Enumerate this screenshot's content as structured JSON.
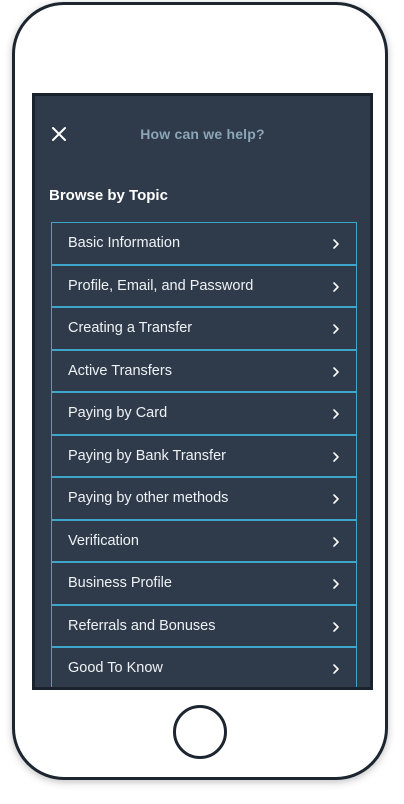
{
  "header": {
    "title": "How can we help?",
    "close_icon": "close-icon"
  },
  "browse": {
    "title": "Browse by Topic",
    "topics": [
      {
        "label": "Basic Information"
      },
      {
        "label": "Profile, Email, and Password"
      },
      {
        "label": "Creating a Transfer"
      },
      {
        "label": "Active Transfers"
      },
      {
        "label": "Paying by Card"
      },
      {
        "label": "Paying by Bank Transfer"
      },
      {
        "label": "Paying by other methods"
      },
      {
        "label": "Verification"
      },
      {
        "label": "Business Profile"
      },
      {
        "label": "Referrals and Bonuses"
      },
      {
        "label": "Good To Know"
      }
    ],
    "row_icon": "chevron-right-icon"
  },
  "colors": {
    "screen_bg": "#2f3b4a",
    "accent_border": "#3ea6c8",
    "title_text": "#8ca6b8",
    "item_text": "#eef2f5"
  }
}
